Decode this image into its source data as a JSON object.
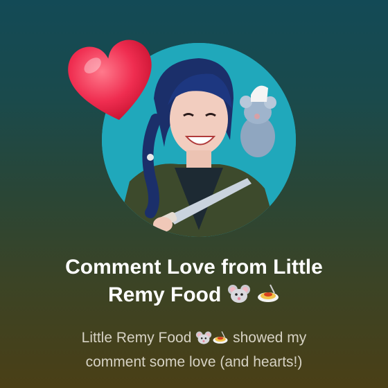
{
  "notification": {
    "title_line1": "Comment Love from Little",
    "title_line2": "Remy Food",
    "subtitle_line1": "Little Remy Food",
    "subtitle_line1_tail": "showed my",
    "subtitle_line2": "comment some love (and hearts!)",
    "title_emoji_1": "mouse-face",
    "title_emoji_2": "spaghetti",
    "subtitle_emoji_1": "mouse-face",
    "subtitle_emoji_2": "spaghetti"
  },
  "colors": {
    "background_top": "#134a56",
    "background_bottom": "#4a3f16",
    "avatar_bg": "#1fa7ba",
    "heart": "#ef2d50",
    "title": "#ffffff",
    "subtitle": "#d6d2c4"
  }
}
